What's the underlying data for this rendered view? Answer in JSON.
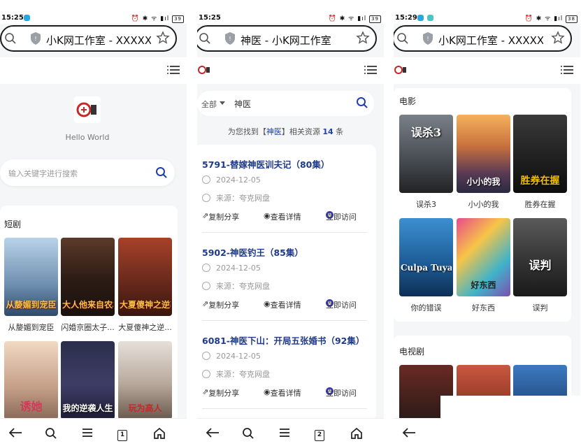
{
  "screens": [
    {
      "status": {
        "time": "15:25",
        "battery": "39"
      },
      "url": "小K网工作室 - XXXXX...",
      "hello": "Hello World",
      "search_placeholder": "输入关键字进行搜索",
      "section_title": "短剧",
      "posters": [
        {
          "title": "从嫠媚到宠臣",
          "art": "从嫠媚到宠臣"
        },
        {
          "title": "闪婚京圈太子...",
          "art": "大人他来自农村"
        },
        {
          "title": "大夏傻神之逆...",
          "art": "大夏傻神之逆袭"
        },
        {
          "title": "",
          "art": "诱她"
        },
        {
          "title": "",
          "art": "我的逆袭人生"
        },
        {
          "title": "",
          "art": "玩为高人"
        }
      ],
      "tab_count": "1"
    },
    {
      "status": {
        "time": "15:25",
        "battery": "39"
      },
      "url": "神医 - 小K网工作室",
      "filter": {
        "scope": "全部",
        "query": "神医"
      },
      "found": {
        "prefix": "为您找到【",
        "keyword": "神医",
        "middle": "】相关资源 ",
        "count": "14",
        "suffix": " 条"
      },
      "results": [
        {
          "title": "5791-替嫁神医训夫记（80集）",
          "date": "2024-12-05",
          "source": "来源：夸克网盘"
        },
        {
          "title": "5902-神医钓王（85集）",
          "date": "2024-12-05",
          "source": "来源：夸克网盘"
        },
        {
          "title": "6081-神医下山：开局五张婚书（92集）",
          "date": "2024-12-05",
          "source": "来源：夸克网盘"
        }
      ],
      "actions": {
        "share": "复制分享",
        "detail": "查看详情",
        "visit": "立即访问"
      },
      "tab_count": "2"
    },
    {
      "status": {
        "time": "15:29",
        "battery": "38"
      },
      "url": "小K网工作室 - XXXXX...",
      "movies_title": "电影",
      "movies": [
        {
          "title": "误杀3",
          "art": "误杀3"
        },
        {
          "title": "小小的我",
          "art": "小小的我"
        },
        {
          "title": "胜券在握",
          "art": "胜券在握"
        },
        {
          "title": "你的错误",
          "art": "Culpa Tuya"
        },
        {
          "title": "好东西",
          "art": "好东西"
        },
        {
          "title": "误判",
          "art": "误判"
        }
      ],
      "tv_title": "电视剧"
    }
  ],
  "colors": {
    "link_blue": "#1e3a8a",
    "accent": "#1e40af",
    "bg": "#f5f6f8"
  }
}
